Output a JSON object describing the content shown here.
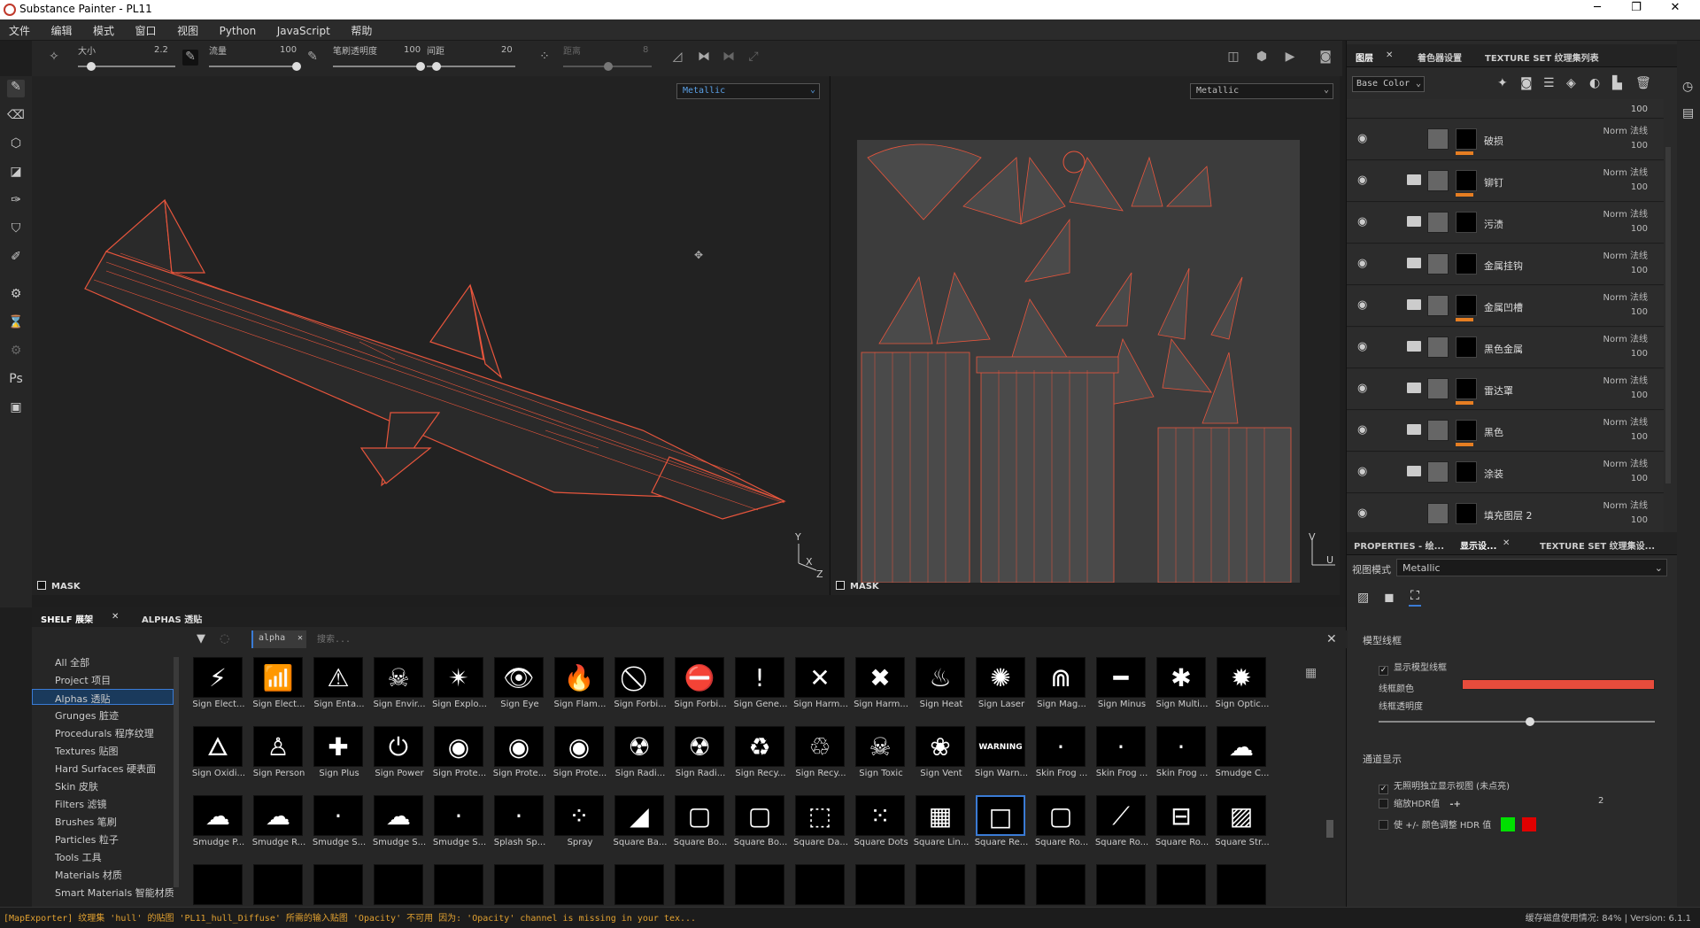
{
  "app": {
    "title": "Substance Painter - PL11",
    "min_icon": "minimize-icon",
    "max_icon": "maximize-icon",
    "close_icon": "close-icon"
  },
  "menu": [
    "文件",
    "编辑",
    "模式",
    "窗口",
    "视图",
    "Python",
    "JavaScript",
    "帮助"
  ],
  "toolbar": {
    "size_label": "大小",
    "size_value": "2.2",
    "flow_label": "流量",
    "flow_value": "100",
    "opacity_label": "笔刷透明度",
    "opacity_value": "100",
    "spacing_label": "间距",
    "spacing_value": "20",
    "distance_label": "距离",
    "distance_value": "8"
  },
  "viewport3d": {
    "channel": "Metallic",
    "mask_label": "MASK",
    "axis_y": "Y",
    "axis_x": "X",
    "axis_z": "Z"
  },
  "viewport2d": {
    "channel": "Metallic",
    "mask_label": "MASK",
    "axis_v": "V",
    "axis_u": "U"
  },
  "layers_panel": {
    "tabs": [
      "图层",
      "着色器设置",
      "TEXTURE SET 纹理集列表"
    ],
    "channel": "Base Color",
    "top_partial_opacity": "100",
    "layers": [
      {
        "name": "破损",
        "blend": "Norm 法线",
        "opacity": "100",
        "folder": false,
        "orange": true
      },
      {
        "name": "铆钉",
        "blend": "Norm 法线",
        "opacity": "100",
        "folder": true,
        "orange": true
      },
      {
        "name": "污渍",
        "blend": "Norm 法线",
        "opacity": "100",
        "folder": true,
        "orange": false
      },
      {
        "name": "金属挂钩",
        "blend": "Norm 法线",
        "opacity": "100",
        "folder": true,
        "orange": false
      },
      {
        "name": "金属凹槽",
        "blend": "Norm 法线",
        "opacity": "100",
        "folder": true,
        "orange": true
      },
      {
        "name": "黑色金属",
        "blend": "Norm 法线",
        "opacity": "100",
        "folder": true,
        "orange": false
      },
      {
        "name": "雷达罩",
        "blend": "Norm 法线",
        "opacity": "100",
        "folder": true,
        "orange": true
      },
      {
        "name": "黑色",
        "blend": "Norm 法线",
        "opacity": "100",
        "folder": true,
        "orange": true
      },
      {
        "name": "涂装",
        "blend": "Norm 法线",
        "opacity": "100",
        "folder": true,
        "orange": false
      },
      {
        "name": "填充图层 2",
        "blend": "Norm 法线",
        "opacity": "100",
        "folder": false,
        "orange": false
      }
    ]
  },
  "props_panel": {
    "tabs": [
      "PROPERTIES - 绘...",
      "显示设...",
      "TEXTURE SET 纹理集设..."
    ],
    "view_mode_label": "视图模式",
    "view_mode_value": "Metallic",
    "wireframe_section": "模型线框",
    "show_wireframe": "显示模型线框",
    "wire_color_label": "线框颜色",
    "wire_opacity_label": "线框透明度",
    "wire_opacity_value": 0.55,
    "channel_section": "通道显示",
    "hdr_independent": "无照明独立显示视图 (未点亮)",
    "hdr_label": "缩放HDR值",
    "hdr_value": "2",
    "hdr_minus": "-",
    "hdr_plus": "+",
    "hdr_adjust": "使 +/- 颜色调整 HDR 值",
    "wire_color": "#e74c3c"
  },
  "shelf": {
    "tabs": [
      "SHELF 展架",
      "ALPHAS 透贴"
    ],
    "filter_tag": "alpha",
    "search_placeholder": "搜索...",
    "categories": [
      "All 全部",
      "Project 项目",
      "Alphas 透贴",
      "Grunges 脏迹",
      "Procedurals 程序纹理",
      "Textures 贴图",
      "Hard Surfaces 硬表面",
      "Skin 皮肤",
      "Filters 滤镜",
      "Brushes 笔刷",
      "Particles 粒子",
      "Tools 工具",
      "Materials 材质",
      "Smart Materials 智能材质"
    ],
    "row1": [
      "Sign Elect...",
      "Sign Elect...",
      "Sign Enta...",
      "Sign Envir...",
      "Sign Explo...",
      "Sign Eye",
      "Sign Flam...",
      "Sign Forbi...",
      "Sign Forbi...",
      "Sign Gene...",
      "Sign Harm...",
      "Sign Harm...",
      "Sign Heat",
      "Sign Laser",
      "Sign Mag...",
      "Sign Minus",
      "Sign Multi...",
      "Sign Optic..."
    ],
    "row2": [
      "Sign Oxidi...",
      "Sign Person",
      "Sign Plus",
      "Sign Power",
      "Sign Prote...",
      "Sign Prote...",
      "Sign Prote...",
      "Sign Radi...",
      "Sign Radi...",
      "Sign Recy...",
      "Sign Recy...",
      "Sign Toxic",
      "Sign Vent",
      "Sign Warn...",
      "Skin Frog ...",
      "Skin Frog ...",
      "Skin Frog ...",
      "Smudge C..."
    ],
    "row3": [
      "Smudge P...",
      "Smudge R...",
      "Smudge S...",
      "Smudge S...",
      "Smudge S...",
      "Splash Sp...",
      "Spray",
      "Square Ba...",
      "Square Bo...",
      "Square Bo...",
      "Square Da...",
      "Square Dots",
      "Square Lin...",
      "Square Re...",
      "Square Ro...",
      "Square Ro...",
      "Square Ro...",
      "Square Str..."
    ],
    "icons1": [
      "⚡",
      "📶",
      "⚠",
      "☠",
      "✴",
      "👁",
      "🔥",
      "⃠",
      "⛔",
      "!",
      "✕",
      "✖",
      "♨",
      "✺",
      "⋒",
      "━",
      "✱",
      "✹"
    ],
    "icons2": [
      "🜂",
      "♙",
      "✚",
      "⏻",
      "◉",
      "◉",
      "◉",
      "☢",
      "☢",
      "♻",
      "♲",
      "☠",
      "❀",
      "WARNING",
      "·",
      "·",
      "·",
      "☁"
    ],
    "icons3": [
      "☁",
      "☁",
      "·",
      "☁",
      "·",
      "·",
      "⁘",
      "◢",
      "▢",
      "▢",
      "⬚",
      "⁙",
      "▦",
      "□",
      "▢",
      "⟋",
      "⊟",
      "▨"
    ],
    "warning_text": "WARNING"
  },
  "status": {
    "error": "[MapExporter] 纹理集 'hull' 的贴图 'PL11_hull_Diffuse' 所需的输入贴图 'Opacity' 不可用 因为: 'Opacity' channel is missing in your tex...",
    "memory": "缓存磁盘使用情况:  84% | Version: 6.1.1"
  }
}
